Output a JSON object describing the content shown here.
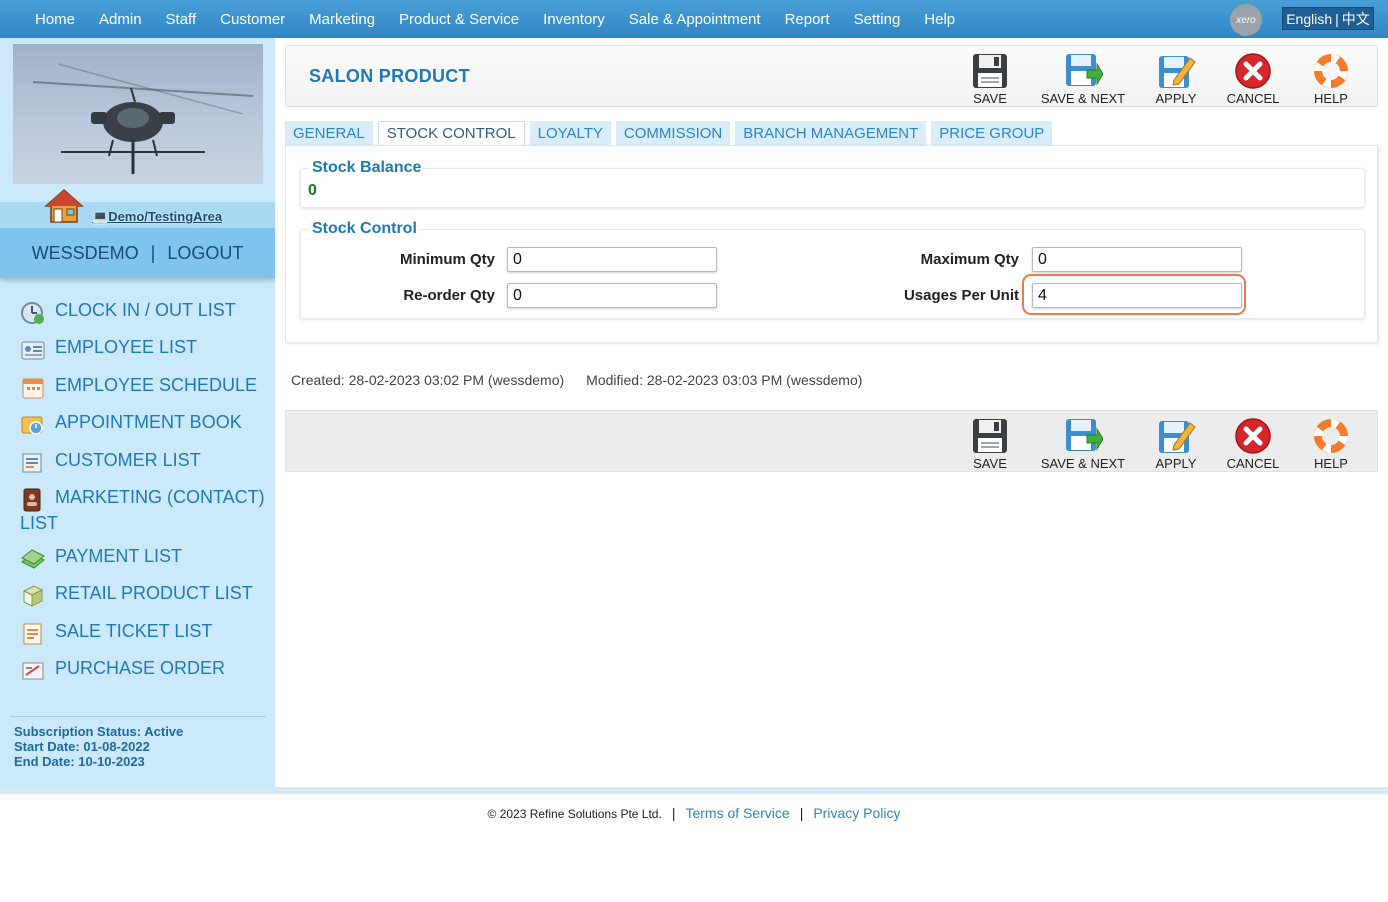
{
  "nav": {
    "items": [
      "Home",
      "Admin",
      "Staff",
      "Customer",
      "Marketing",
      "Product & Service",
      "Inventory",
      "Sale & Appointment",
      "Report",
      "Setting",
      "Help"
    ],
    "xero": "xero",
    "lang_en": "English",
    "lang_sep": "|",
    "lang_zh": "中文"
  },
  "sidebar": {
    "area": "Demo/TestingArea",
    "username": "WESSDEMO",
    "user_sep": "|",
    "logout": "LOGOUT",
    "links": [
      {
        "label": "CLOCK IN / OUT LIST",
        "icon": "clock-icon"
      },
      {
        "label": "EMPLOYEE LIST",
        "icon": "employee-card-icon"
      },
      {
        "label": "EMPLOYEE SCHEDULE",
        "icon": "calendar-icon"
      },
      {
        "label": "APPOINTMENT BOOK",
        "icon": "appointment-book-icon"
      },
      {
        "label": "CUSTOMER LIST",
        "icon": "customer-list-icon"
      },
      {
        "label": "MARKETING (CONTACT)",
        "label2": "LIST",
        "icon": "contact-book-icon"
      },
      {
        "label": "PAYMENT LIST",
        "icon": "money-icon"
      },
      {
        "label": "RETAIL PRODUCT LIST",
        "icon": "product-box-icon"
      },
      {
        "label": "SALE TICKET LIST",
        "icon": "sale-ticket-icon"
      },
      {
        "label": "PURCHASE ORDER",
        "icon": "purchase-order-icon"
      }
    ],
    "subscription": {
      "status": "Subscription Status: Active",
      "start": "Start Date: 01-08-2022",
      "end": "End Date: 10-10-2023"
    }
  },
  "page": {
    "title": "SALON PRODUCT",
    "toolbar": {
      "save": "SAVE",
      "save_next": "SAVE & NEXT",
      "apply": "APPLY",
      "cancel": "CANCEL",
      "help": "HELP"
    },
    "tabs": [
      "GENERAL",
      "STOCK CONTROL",
      "LOYALTY",
      "COMMISSION",
      "BRANCH MANAGEMENT",
      "PRICE GROUP"
    ],
    "active_tab": "STOCK CONTROL",
    "stock_balance": {
      "legend": "Stock Balance",
      "value": "0"
    },
    "stock_control": {
      "legend": "Stock Control",
      "min_label": "Minimum Qty",
      "min_value": "0",
      "max_label": "Maximum Qty",
      "max_value": "0",
      "reorder_label": "Re-order Qty",
      "reorder_value": "0",
      "usages_label": "Usages Per Unit",
      "usages_value": "4"
    },
    "created": "Created: 28-02-2023 03:02 PM (wessdemo)",
    "modified": "Modified: 28-02-2023 03:03 PM (wessdemo)"
  },
  "footer": {
    "copyright": "© 2023 Refine Solutions Pte Ltd.",
    "sep": "|",
    "terms": "Terms of Service",
    "privacy": "Privacy Policy"
  },
  "colors": {
    "nav_bg": "#3a93cf",
    "sidebar_bg": "#cbe9fa",
    "link": "#1d7ab6",
    "highlight_ring": "#f07a46",
    "balance_green": "#1b7a16"
  }
}
